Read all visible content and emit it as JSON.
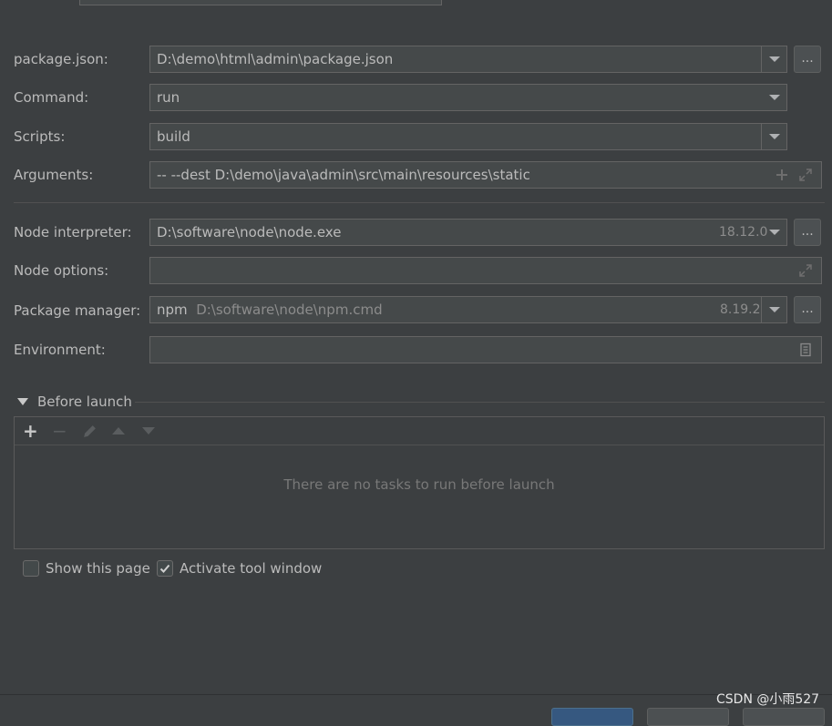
{
  "form": {
    "package_json": {
      "label": "package.json:",
      "value": "D:\\demo\\html\\admin\\package.json"
    },
    "command": {
      "label": "Command:",
      "value": "run"
    },
    "scripts": {
      "label": "Scripts:",
      "value": "build"
    },
    "arguments": {
      "label": "Arguments:",
      "value": "-- --dest  D:\\demo\\java\\admin\\src\\main\\resources\\static"
    },
    "node_interpreter": {
      "label": "Node interpreter:",
      "value": "D:\\software\\node\\node.exe",
      "version": "18.12.0"
    },
    "node_options": {
      "label": "Node options:",
      "value": ""
    },
    "package_manager": {
      "label": "Package manager:",
      "name": "npm",
      "path": "D:\\software\\node\\npm.cmd",
      "version": "8.19.2"
    },
    "environment": {
      "label": "Environment:",
      "value": ""
    },
    "browse_label": "..."
  },
  "before_launch": {
    "title": "Before launch",
    "empty_text": "There are no tasks to run before launch",
    "toolbar": {
      "add": "+",
      "remove": "−"
    }
  },
  "options": {
    "show_page": {
      "label": "Show this page",
      "checked": false
    },
    "activate_tool_window": {
      "label": "Activate tool window",
      "checked": true
    }
  },
  "watermark": "CSDN @小雨527",
  "colors": {
    "background": "#3c3f41",
    "field_bg": "#45494a",
    "border": "#646464",
    "text": "#bbbbbb",
    "dim_text": "#8c8c8c",
    "primary_button": "#365880"
  }
}
